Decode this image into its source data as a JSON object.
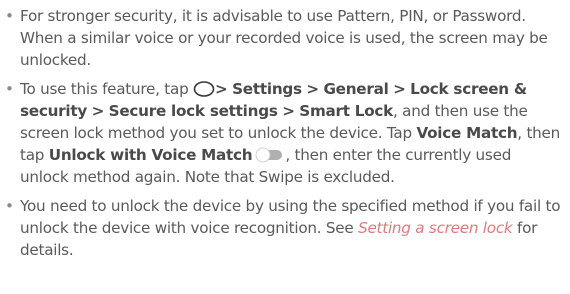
{
  "bullets": {
    "b1": {
      "text": "For stronger security, it is advisable to use Pattern, PIN, or Password. When a similar voice or your recorded voice is used, the screen may be unlocked."
    },
    "b2": {
      "intro": "To use this feature, tap ",
      "sep": ">",
      "settings": "Settings",
      "general": "General",
      "lock_screen_security": "Lock screen & security",
      "secure_lock_settings": "Secure lock settings",
      "smart_lock": "Smart Lock",
      "after_smart_lock": ", and then use the screen lock method you set to unlock the device. Tap ",
      "voice_match": "Voice Match",
      "then_tap": ", then tap ",
      "unlock_with_voice_match": "Unlock with Voice Match",
      "tail": ", then enter the currently used unlock method again. Note that Swipe is excluded."
    },
    "b3": {
      "before_link": "You need to unlock the device by using the specified method if you fail to unlock the device with voice recognition. See ",
      "link": "Setting a screen lock",
      "after_link": " for details."
    }
  },
  "icons": {
    "home": "home-button-icon",
    "toggle": "toggle-off-icon"
  },
  "colors": {
    "text": "#5a5a5a",
    "bold": "#4a4a4a",
    "link": "#e07a7e"
  }
}
